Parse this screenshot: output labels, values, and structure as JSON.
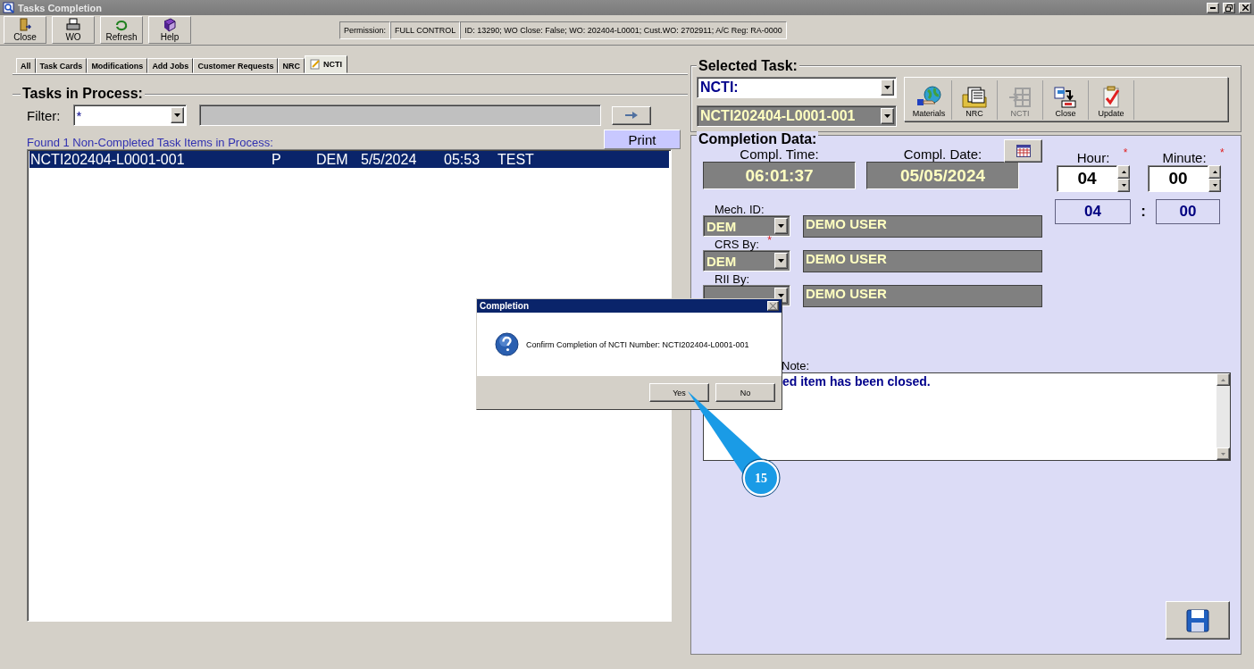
{
  "window": {
    "title": "Tasks Completion"
  },
  "toolbar": [
    {
      "label": "Close"
    },
    {
      "label": "WO"
    },
    {
      "label": "Refresh"
    },
    {
      "label": "Help"
    }
  ],
  "permission": {
    "label": "Permission:",
    "value": "FULL CONTROL",
    "info": "ID: 13290; WO Close: False; WO: 202404-L0001; Cust.WO: 2702911; A/C Reg: RA-0000"
  },
  "tabs": [
    {
      "label": "All",
      "selected": false
    },
    {
      "label": "Task Cards",
      "selected": false
    },
    {
      "label": "Modifications",
      "selected": false
    },
    {
      "label": "Add Jobs",
      "selected": false
    },
    {
      "label": "Customer Requests",
      "selected": false
    },
    {
      "label": "NRC",
      "selected": false
    },
    {
      "label": "NCTI",
      "selected": true
    }
  ],
  "tasks_panel": {
    "title": "Tasks in Process:",
    "filter_label": "Filter:",
    "filter_value": "*",
    "found_text": "Found 1 Non-Completed Task Items in Process:",
    "print_button": "Print",
    "rows": [
      {
        "cells": [
          "NCTI202404-L0001-001",
          "P",
          "DEM",
          "5/5/2024",
          "05:53",
          "TEST"
        ],
        "selected": true
      }
    ]
  },
  "selected_task": {
    "title": "Selected Task:",
    "type_value": "NCTI:",
    "task_value": "NCTI202404-L0001-001",
    "actions": [
      {
        "label": "Materials",
        "disabled": false
      },
      {
        "label": "NRC",
        "disabled": false
      },
      {
        "label": "NCTI",
        "disabled": true
      },
      {
        "label": "Close",
        "disabled": false
      },
      {
        "label": "Update",
        "disabled": false
      }
    ]
  },
  "completion": {
    "title": "Completion Data:",
    "compl_time_label": "Compl. Time:",
    "compl_time": "06:01:37",
    "compl_date_label": "Compl. Date:",
    "compl_date": "05/05/2024",
    "hour_label": "Hour:",
    "hour_required_mark": "*",
    "hour": "04",
    "minute_label": "Minute:",
    "minute_required_mark": "*",
    "minute": "00",
    "hour_display": "04",
    "separator": ":",
    "minute_display": "00",
    "people": [
      {
        "label": "Mech. ID:",
        "code": "DEM",
        "name": "DEMO USER"
      },
      {
        "label": "CRS By:",
        "required_mark": "*",
        "code": "DEM",
        "name": "DEMO USER"
      },
      {
        "label": "RII By:",
        "name": "DEMO USER"
      }
    ],
    "note_label": "Note:",
    "note": "ed item has been closed."
  },
  "dialog": {
    "title": "Completion",
    "message": "Confirm Completion of NCTI Number: NCTI202404-L0001-001",
    "buttons": [
      "Yes",
      "No"
    ]
  },
  "callout": {
    "number": "15"
  }
}
